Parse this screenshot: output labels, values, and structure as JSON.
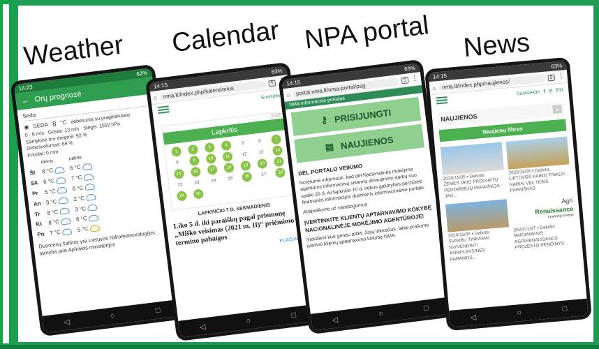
{
  "sections": [
    "Weather",
    "Calendar",
    "NPA portal",
    "News"
  ],
  "colors": {
    "accent": "#1f9d55",
    "frame": "#16a34a",
    "light_green": "#8bc34a"
  },
  "weather": {
    "status_time": "14:23",
    "status_right": "62%",
    "title": "Orų prognozė",
    "place": "Seda",
    "station": "SEDA",
    "temp": "8",
    "unit": "°C",
    "desc": "debesuota su pragiedruliais",
    "wind": "0 - 8 m/s",
    "gusts": "Gūsiai: 13 m/s",
    "pressure": "Slėgis: 1002 hPa",
    "humidity": "Santykinė oro drėgmė: 92 %",
    "clouds": "Debesuotumas: 69 %",
    "precip": "Krituliai: 0 mm",
    "col_day": "diena",
    "col_night": "naktis",
    "days": [
      {
        "d": "Št",
        "day": "8 °C",
        "night": "6 °C"
      },
      {
        "d": "Sk",
        "day": "6 °C",
        "night": "7 °C"
      },
      {
        "d": "Pr",
        "day": "5 °C",
        "night": "6 °C"
      },
      {
        "d": "An",
        "day": "3 °C",
        "night": "2 °C"
      },
      {
        "d": "Tr",
        "day": "8 °C",
        "night": "3 °C"
      },
      {
        "d": "Kt",
        "day": "8 °C",
        "night": "6 °C"
      },
      {
        "d": "Pn",
        "day": "7 °C",
        "night": "5 °C"
      }
    ],
    "source": "Duomenų šaltinis yra Lietuvos hidrometeorologijos tarnyba prie Aplinkos ministerijos"
  },
  "calendar": {
    "status_time": "14:15",
    "status_right": "63%",
    "url": "nma.lt/index.php/kalendorius",
    "tabs": "5",
    "contact": "Susisiekite",
    "year": "2020",
    "month": "Lapkritis",
    "days": [
      "1",
      "2",
      "3",
      "4",
      "5",
      "6",
      "7",
      "8",
      "9",
      "10",
      "11",
      "12",
      "13",
      "14",
      "15",
      "16",
      "17",
      "18",
      "19",
      "20",
      "21",
      "22",
      "23",
      "24",
      "25",
      "26",
      "27",
      "28",
      "29",
      "30"
    ],
    "highlighted": [
      "1",
      "2",
      "3",
      "4",
      "7",
      "9",
      "10",
      "11",
      "14",
      "15",
      "16",
      "17",
      "18",
      "19",
      "20",
      "21",
      "26",
      "28",
      "29",
      "30"
    ],
    "date_label": "LAPKRIČIO 7 D. SEKMADIENIS",
    "news": "Liko 5 d. iki paraiškų pagal priemonę „Miško veisimas (2021 m. II)“ priėmimo termino pabaigos",
    "more": "PLAČIAU"
  },
  "npa": {
    "status_time": "14:15",
    "status_right": "63%",
    "url": "portal.nma.lt/nma-portal/pag",
    "tabs": "5",
    "portal_title": "NMA informacinė portalas",
    "login": "PRISIJUNGTI",
    "news": "NAUJIENOS",
    "heading": "DĖL PORTALO VEIKIMO",
    "body": "Norėtume informuoti, kad dėl Nacionalinės mokėjimo agentūros informacinių sistemų atnaujinimo darbų nuo spalio 29 d. iki lapkričio 10 d. nebus galimybės peržiūrėti finansinės informacijos duomenis informaciniame portale.",
    "thanks": "Atsiprašome už nepatogumus",
    "heading2": "ĮVERTINKITE KLIENTŲ APTARNAVIMO KOKYBĘ NACIONALINĖJE MOKĖJIMO AGENTŪROJE!",
    "body2": "Siekdami kuo geriau atlikti Jūsų lūkesčius, labai prašome įvertinti klientų aptarnavimo kokybę NMA."
  },
  "news": {
    "status_time": "14:15",
    "status_right": "63%",
    "url": "nma.lt/index.php/naujienos/",
    "tabs": "5",
    "contact": "Susisiekite",
    "lang": "EN",
    "title": "NAUJIENOS",
    "filter": "Naujienų filtras",
    "share": "Dalintis",
    "cards": [
      {
        "date": "2020/11/05",
        "title": "ŽEMĖS ŪKIO PRODUKTŲ PERDIRBĖJŲ PARAIŠKOS JAU..."
      },
      {
        "date": "2020/11/05",
        "title": "LIETUVOS KAIMO TINKLO NARIAI VEL TEIKS PARAIŠKAS"
      },
      {
        "date": "2020/11/05",
        "title": "SVARBU TINKAMAI ĮGYVENDINTI KOMPLEKSINES PARAMOS..."
      },
      {
        "date": "2020/11/27",
        "title": "BAIGIAMASIS AGRIRENAISSANCE PROJEKTO RENGINYS"
      }
    ],
    "logo_top": "Agri",
    "logo_main": "Renaissance",
    "logo_sub": "Learning Europe"
  }
}
